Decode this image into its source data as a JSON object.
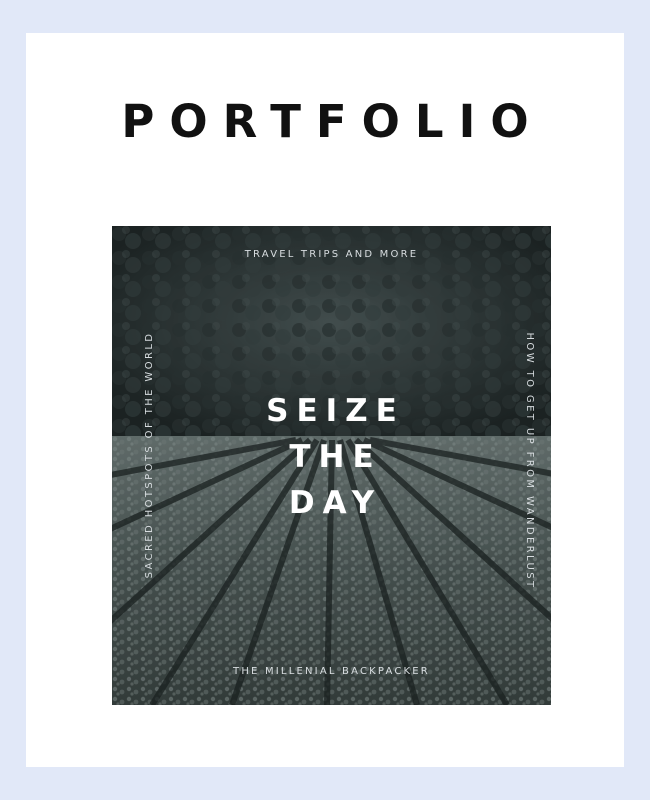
{
  "page": {
    "title": "PORTFOLIO"
  },
  "cover": {
    "top_text": "TRAVEL TRIPS AND MORE",
    "headline": [
      "SEIZE",
      "THE",
      "DAY"
    ],
    "left_vertical": "SACRED HOTSPOTS OF THE WORLD",
    "right_vertical": "HOW TO GET UP FROM WANDERLUST",
    "bottom_text": "THE MILLENIAL BACKPACKER"
  },
  "colors": {
    "background": "#e1e8f8",
    "card": "#ffffff",
    "title": "#111111",
    "cover_text": "#d8dde0"
  }
}
